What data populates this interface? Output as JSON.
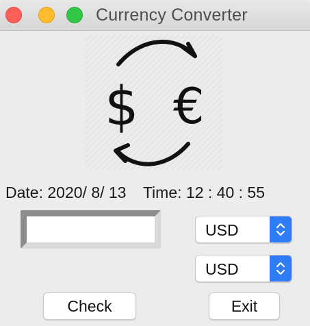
{
  "window": {
    "title": "Currency Converter"
  },
  "logo": {
    "icon": "currency-exchange-icon",
    "left_symbol": "$",
    "right_symbol": "€"
  },
  "status": {
    "date_label": "Date:",
    "date_value": "2020/ 8/ 13",
    "time_label": "Time:",
    "time_value": "12 : 40 : 55"
  },
  "amount": {
    "value": ""
  },
  "from_currency": {
    "selected": "USD"
  },
  "to_currency": {
    "selected": "USD"
  },
  "buttons": {
    "check_label": "Check",
    "exit_label": "Exit"
  },
  "colors": {
    "close": "#fc5f57",
    "minimize": "#fdbc2e",
    "maximize": "#33c748",
    "accent": "#2f7cf6"
  }
}
